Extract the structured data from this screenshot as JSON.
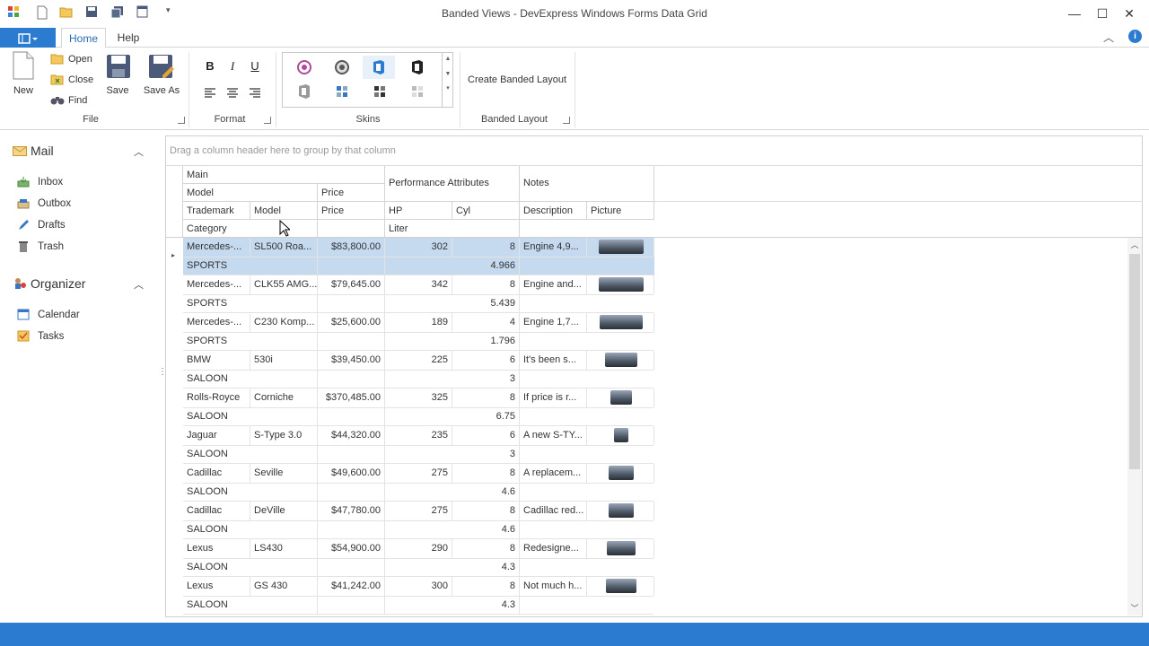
{
  "window": {
    "title": "Banded Views - DevExpress Windows Forms Data Grid"
  },
  "ribbon": {
    "tabs": [
      "Home",
      "Help"
    ],
    "file": {
      "new": "New",
      "open": "Open",
      "close": "Close",
      "find": "Find",
      "save": "Save",
      "save_as": "Save As",
      "group": "File"
    },
    "format": {
      "bold": "B",
      "italic": "I",
      "underline": "U",
      "group": "Format"
    },
    "skins": {
      "group": "Skins"
    },
    "banded": {
      "create": "Create Banded Layout",
      "group": "Banded Layout"
    }
  },
  "nav": {
    "mail": {
      "title": "Mail",
      "items": [
        "Inbox",
        "Outbox",
        "Drafts",
        "Trash"
      ]
    },
    "organizer": {
      "title": "Organizer",
      "items": [
        "Calendar",
        "Tasks"
      ]
    }
  },
  "grid": {
    "group_panel": "Drag a column header here to group by that column",
    "bands": {
      "main": "Main",
      "model": "Model",
      "price": "Price",
      "performance": "Performance Attributes",
      "notes": "Notes"
    },
    "columns": {
      "trademark": "Trademark",
      "model": "Model",
      "price": "Price",
      "hp": "HP",
      "cyl": "Cyl",
      "description": "Description",
      "picture": "Picture",
      "category": "Category",
      "liter": "Liter"
    },
    "rows": [
      {
        "trademark": "Mercedes-...",
        "model": "SL500 Roa...",
        "price": "$83,800.00",
        "hp": "302",
        "cyl": "8",
        "description": "Engine 4,9...",
        "category": "SPORTS",
        "liter": "4.966"
      },
      {
        "trademark": "Mercedes-...",
        "model": "CLK55 AMG...",
        "price": "$79,645.00",
        "hp": "342",
        "cyl": "8",
        "description": "Engine and...",
        "category": "SPORTS",
        "liter": "5.439"
      },
      {
        "trademark": "Mercedes-...",
        "model": "C230 Komp...",
        "price": "$25,600.00",
        "hp": "189",
        "cyl": "4",
        "description": "Engine 1,7...",
        "category": "SPORTS",
        "liter": "1.796"
      },
      {
        "trademark": "BMW",
        "model": "530i",
        "price": "$39,450.00",
        "hp": "225",
        "cyl": "6",
        "description": " It's been s...",
        "category": "SALOON",
        "liter": "3"
      },
      {
        "trademark": "Rolls-Royce",
        "model": "Corniche",
        "price": "$370,485.00",
        "hp": "325",
        "cyl": "8",
        "description": "If price is r...",
        "category": "SALOON",
        "liter": "6.75"
      },
      {
        "trademark": "Jaguar",
        "model": "S-Type 3.0",
        "price": "$44,320.00",
        "hp": "235",
        "cyl": "6",
        "description": "A new S-TY...",
        "category": "SALOON",
        "liter": "3"
      },
      {
        "trademark": "Cadillac",
        "model": "Seville",
        "price": "$49,600.00",
        "hp": "275",
        "cyl": "8",
        "description": "A replacem...",
        "category": "SALOON",
        "liter": "4.6"
      },
      {
        "trademark": "Cadillac",
        "model": "DeVille",
        "price": "$47,780.00",
        "hp": "275",
        "cyl": "8",
        "description": "Cadillac red...",
        "category": "SALOON",
        "liter": "4.6"
      },
      {
        "trademark": "Lexus",
        "model": "LS430",
        "price": "$54,900.00",
        "hp": "290",
        "cyl": "8",
        "description": "Redesigne...",
        "category": "SALOON",
        "liter": "4.3"
      },
      {
        "trademark": "Lexus",
        "model": "GS 430",
        "price": "$41,242.00",
        "hp": "300",
        "cyl": "8",
        "description": "Not much h...",
        "category": "SALOON",
        "liter": "4.3"
      }
    ]
  },
  "colors": {
    "accent": "#2b7bd1",
    "selected_row": "#c5d9ef"
  }
}
